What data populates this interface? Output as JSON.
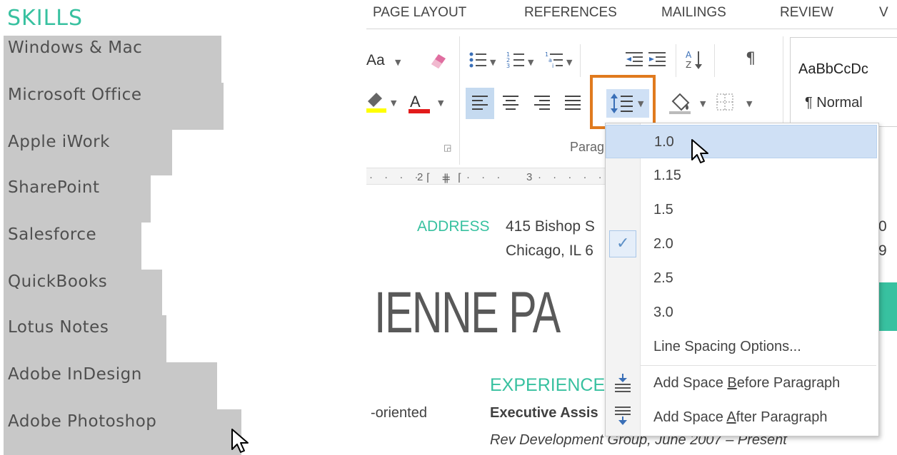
{
  "skills": {
    "title": "SKILLS",
    "items": [
      "Windows & Mac",
      "Microsoft Office",
      "Apple iWork",
      "SharePoint",
      "Salesforce",
      "QuickBooks",
      "Lotus Notes",
      "Adobe InDesign",
      "Adobe Photoshop"
    ]
  },
  "ribbon": {
    "tabs": [
      "PAGE LAYOUT",
      "REFERENCES",
      "MAILINGS",
      "REVIEW",
      "V"
    ],
    "font_case_label": "Aa",
    "group_label": "Parag",
    "styles": {
      "preview": "AaBbCcDc",
      "normal": "¶ Normal"
    }
  },
  "ruler": {
    "marks": [
      "2",
      "3"
    ]
  },
  "document": {
    "address_label": "ADDRESS",
    "address_line1": "415 Bishop S",
    "address_line2": "Chicago, IL 6",
    "right_line1": "0",
    "right_line2": "9",
    "name": "IENNE PA",
    "experience": "EXPERIENCE",
    "oriented": "-oriented",
    "job_title": "Executive Assis",
    "employer_line": "Rev Development Group, June 2007 – Present"
  },
  "line_spacing_menu": {
    "options": [
      "1.0",
      "1.15",
      "1.5",
      "2.0",
      "2.5",
      "3.0"
    ],
    "selected": "2.0",
    "hovered": "1.0",
    "more_options": "Line Spacing Options...",
    "add_before": {
      "pre": "Add Space ",
      "acc": "B",
      "post": "efore Paragraph"
    },
    "add_after": {
      "pre": "Add Space ",
      "acc": "A",
      "post": "fter Paragraph"
    }
  },
  "colors": {
    "accent_teal": "#38c1a0",
    "highlight_orange": "#e07a1e",
    "hover_blue": "#cfe0f5"
  }
}
